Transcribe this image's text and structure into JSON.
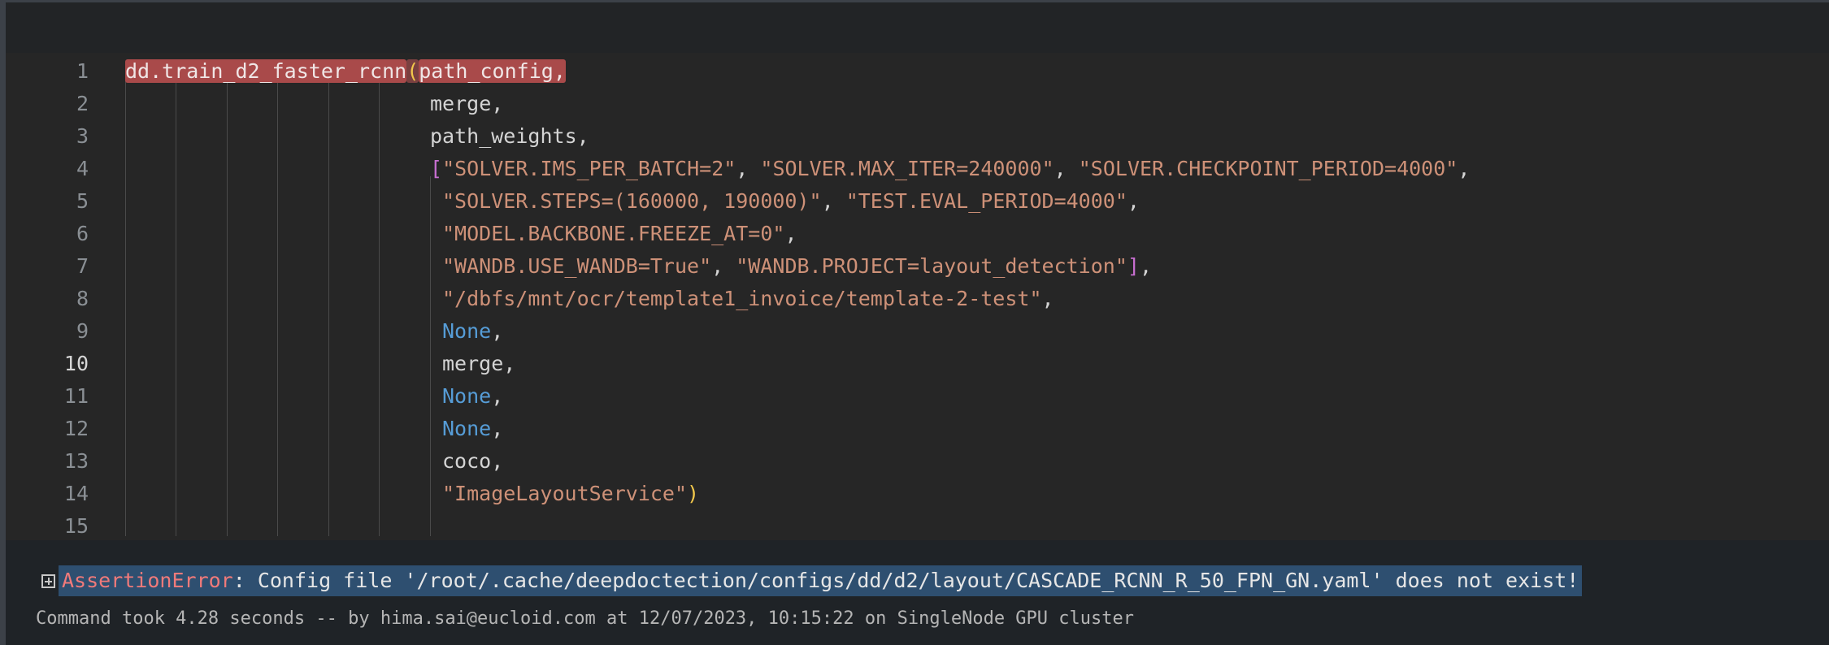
{
  "cell": {
    "line_numbers": [
      "1",
      "2",
      "3",
      "4",
      "5",
      "6",
      "7",
      "8",
      "9",
      "10",
      "11",
      "12",
      "13",
      "14",
      "15"
    ],
    "current_line": "10",
    "lines": {
      "l1_func": "dd.train_d2_faster_rcnn",
      "l1_paren": "(",
      "l1_arg": "path_config,",
      "l2": "merge,",
      "l3": "path_weights,",
      "l4_bracket": "[",
      "l4_s1": "\"SOLVER.IMS_PER_BATCH=2\"",
      "l4_c1": ", ",
      "l4_s2": "\"SOLVER.MAX_ITER=240000\"",
      "l4_c2": ", ",
      "l4_s3": "\"SOLVER.CHECKPOINT_PERIOD=4000\"",
      "l4_c3": ",",
      "l5_s1": "\"SOLVER.STEPS=(160000, 190000)\"",
      "l5_c1": ", ",
      "l5_s2": "\"TEST.EVAL_PERIOD=4000\"",
      "l5_c2": ",",
      "l6_s1": "\"MODEL.BACKBONE.FREEZE_AT=0\"",
      "l6_c1": ",",
      "l7_s1": "\"WANDB.USE_WANDB=True\"",
      "l7_c1": ", ",
      "l7_s2": "\"WANDB.PROJECT=layout_detection\"",
      "l7_bracket": "]",
      "l7_c2": ",",
      "l8_s1": "\"/dbfs/mnt/ocr/template1_invoice/template-2-test\"",
      "l8_c1": ",",
      "l9_none": "None",
      "l9_c": ",",
      "l10": "merge,",
      "l11_none": "None",
      "l11_c": ",",
      "l12_none": "None",
      "l12_c": ",",
      "l13": "coco,",
      "l14_s1": "\"ImageLayoutService\"",
      "l14_paren": ")"
    }
  },
  "output": {
    "error_name": "AssertionError",
    "error_message": ": Config file '/root/.cache/deepdoctection/configs/dd/d2/layout/CASCADE_RCNN_R_50_FPN_GN.yaml' does not exist!",
    "command_info": "Command took 4.28 seconds -- by hima.sai@eucloid.com at 12/07/2023, 10:15:22 on SingleNode GPU cluster"
  },
  "icons": {
    "expand": "plus-square-icon"
  },
  "colors": {
    "background": "#262626",
    "string": "#ce9178",
    "keyword_none": "#569cd6",
    "bracket": "#c86fd1",
    "paren": "#f2c84b",
    "match_highlight": "#a94a4a",
    "error_highlight": "#2e4f70",
    "error_name": "#f07a7a"
  }
}
